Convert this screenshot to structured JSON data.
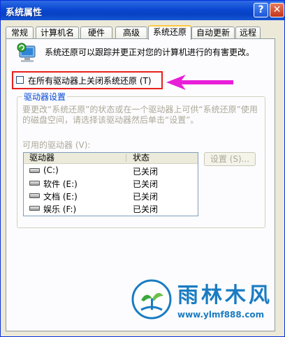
{
  "window": {
    "title": "系统属性",
    "help_glyph": "?",
    "close_glyph": "✕"
  },
  "tabs": [
    {
      "label": "常规"
    },
    {
      "label": "计算机名"
    },
    {
      "label": "硬件"
    },
    {
      "label": "高级"
    },
    {
      "label": "系统还原",
      "active": true
    },
    {
      "label": "自动更新"
    },
    {
      "label": "远程"
    }
  ],
  "system_restore": {
    "description": "系统还原可以跟踪并更正对您的计算机进行的有害更改。",
    "disable_all_label": "在所有驱动器上关闭系统还原 (T)",
    "disable_all_checked": false,
    "group_label": "驱动器设置",
    "info_text": "要更改“系统还原”的状态或在一个驱动器上可供“系统还原”使用的磁盘空间，请选择该驱动器然后单击“设置”。",
    "available_drives_label": "可用的驱动器 (V):",
    "settings_button": "设置 (S)...",
    "columns": [
      "驱动器",
      "状态"
    ],
    "drives": [
      {
        "name": "(C:)",
        "status": "已关闭"
      },
      {
        "name": "软件 (E:)",
        "status": "已关闭"
      },
      {
        "name": "文档 (E:)",
        "status": "已关闭"
      },
      {
        "name": "娱乐 (F:)",
        "status": "已关闭"
      }
    ]
  },
  "watermark": {
    "brand": "雨林木风",
    "url": "www.ylmf888.com"
  },
  "colors": {
    "highlight_box": "#e8201e",
    "arrow": "#e91ed8",
    "title_bar": "#0a48d1"
  }
}
